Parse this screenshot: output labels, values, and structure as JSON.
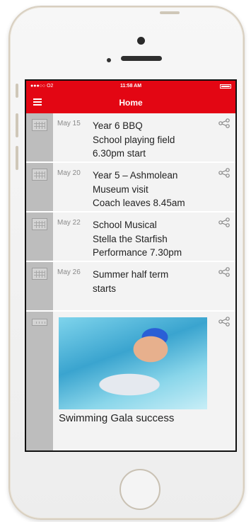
{
  "status_bar": {
    "carrier": "●●●○○ O2",
    "time": "11:58 AM"
  },
  "nav": {
    "title": "Home"
  },
  "events": [
    {
      "date": "May 15",
      "lines": [
        "Year 6 BBQ",
        "School playing field",
        "6.30pm start"
      ]
    },
    {
      "date": "May 20",
      "lines": [
        "Year 5 – Ashmolean",
        "Museum visit",
        "Coach leaves 8.45am"
      ]
    },
    {
      "date": "May 22",
      "lines": [
        "School Musical",
        "Stella the Starfish",
        "Performance 7.30pm"
      ]
    },
    {
      "date": "May 26",
      "lines": [
        "Summer half term",
        "starts"
      ]
    }
  ],
  "news": {
    "title": "Swimming Gala success"
  },
  "icons": {
    "menu": "hamburger-icon",
    "calendar": "calendar-icon",
    "share": "share-icon"
  },
  "colors": {
    "accent": "#e30613",
    "sidebar": "#bdbdbd"
  }
}
